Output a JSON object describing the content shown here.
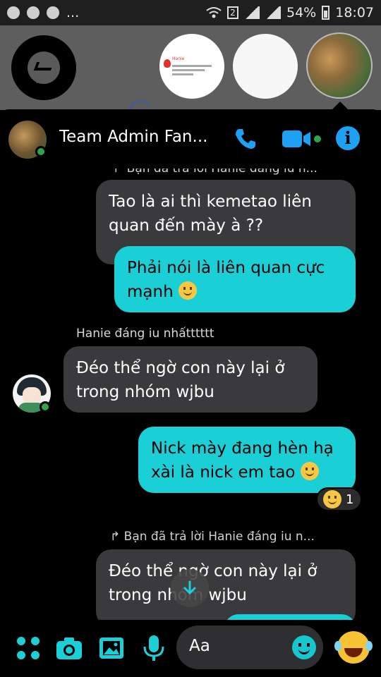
{
  "status_bar": {
    "sim_badge": "2",
    "battery": "54%",
    "time": "18:07",
    "left_icons": [
      "messenger-icon",
      "messenger-icon",
      "camera-icon",
      "more-icon"
    ],
    "more": "..."
  },
  "chat_heads": {
    "notification_preview": "Hanie"
  },
  "header": {
    "title": "Team Admin Fan...",
    "call_icon": "phone-icon",
    "video_icon": "video-icon",
    "info_icon": "info-icon",
    "info_glyph": "i"
  },
  "messages": {
    "top_reply_note": "Bạn đã trả lời Hanie đáng iu n...",
    "grey1": "Tao là ai thì kemetao liên quan đến mày à ??",
    "cyan1": "Phải nói là liên quan cực mạnh",
    "sender_name": "Hanie đáng iu nhấtttttt",
    "grey2": "Đéo thể ngờ con này lại ở trong nhóm wjbu",
    "cyan2": "Nick mày đang hèn hạ xài là nick em tao",
    "reaction_count": "1",
    "reply_note": "Bạn đã trả lời Hanie đáng iu n...",
    "grey3": "Đéo thể ngờ con này lại ở trong nhóm wjbu"
  },
  "composer": {
    "placeholder": "Aa",
    "icons": [
      "apps-icon",
      "camera-icon",
      "image-icon",
      "mic-icon",
      "emoji-icon",
      "laughing-emoji-icon"
    ]
  },
  "colors": {
    "accent": "#1ad0d6",
    "messenger_blue": "#1ea1f3",
    "bubble_grey": "#3a3a3c",
    "online_green": "#31a24c"
  }
}
